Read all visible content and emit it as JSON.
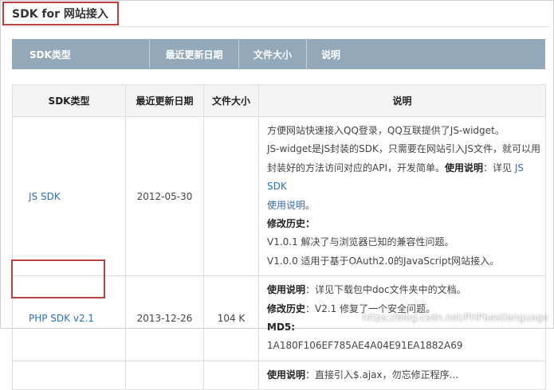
{
  "page": {
    "title": "SDK for 网站接入"
  },
  "header_bar": {
    "col1": "SDK类型",
    "col2": "最近更新日期",
    "col3": "文件大小",
    "col4": "说明"
  },
  "table": {
    "headers": [
      "SDK类型",
      "最近更新日期",
      "文件大小",
      "说明"
    ],
    "rows": [
      {
        "type": "JS SDK",
        "date": "2012-05-30",
        "size": "",
        "desc": {
          "l1": "方便网站快速接入QQ登录，QQ互联提供了JS-widget。",
          "l2": "JS-widget是JS封装的SDK，只需要在网站引入JS文件，就可以用",
          "l3a": "封装好的方法访问对应的API，开发简单。",
          "l3b": "使用说明",
          "l3c": "：详见 ",
          "l3d": "JS SDK",
          "l4": "使用说明",
          "l4b": "。",
          "l5": "修改历史：",
          "l6": "V1.0.1 解决了与浏览器已知的兼容性问题。",
          "l7": "V1.0.0 适用于基于OAuth2.0的JavaScript网站接入。"
        }
      },
      {
        "type": "PHP SDK v2.1",
        "date": "2013-12-26",
        "size": "104 K",
        "desc": {
          "l1a": "使用说明",
          "l1b": "：详见下载包中doc文件夹中的文档。",
          "l2a": "修改历史",
          "l2b": "：V2.1 修复了一个安全问题。",
          "l3": "MD5:",
          "l4": "1A180F106EF785AE4A04E91EA1882A69"
        }
      },
      {
        "type": "",
        "date": "",
        "size": "",
        "desc": {
          "l1a": "使用说明",
          "l1b": "：直接引入$.ajax，勿忘修正程序..."
        }
      }
    ]
  },
  "watermark": "https://blog.csdn.net/PHPbestlanguage"
}
